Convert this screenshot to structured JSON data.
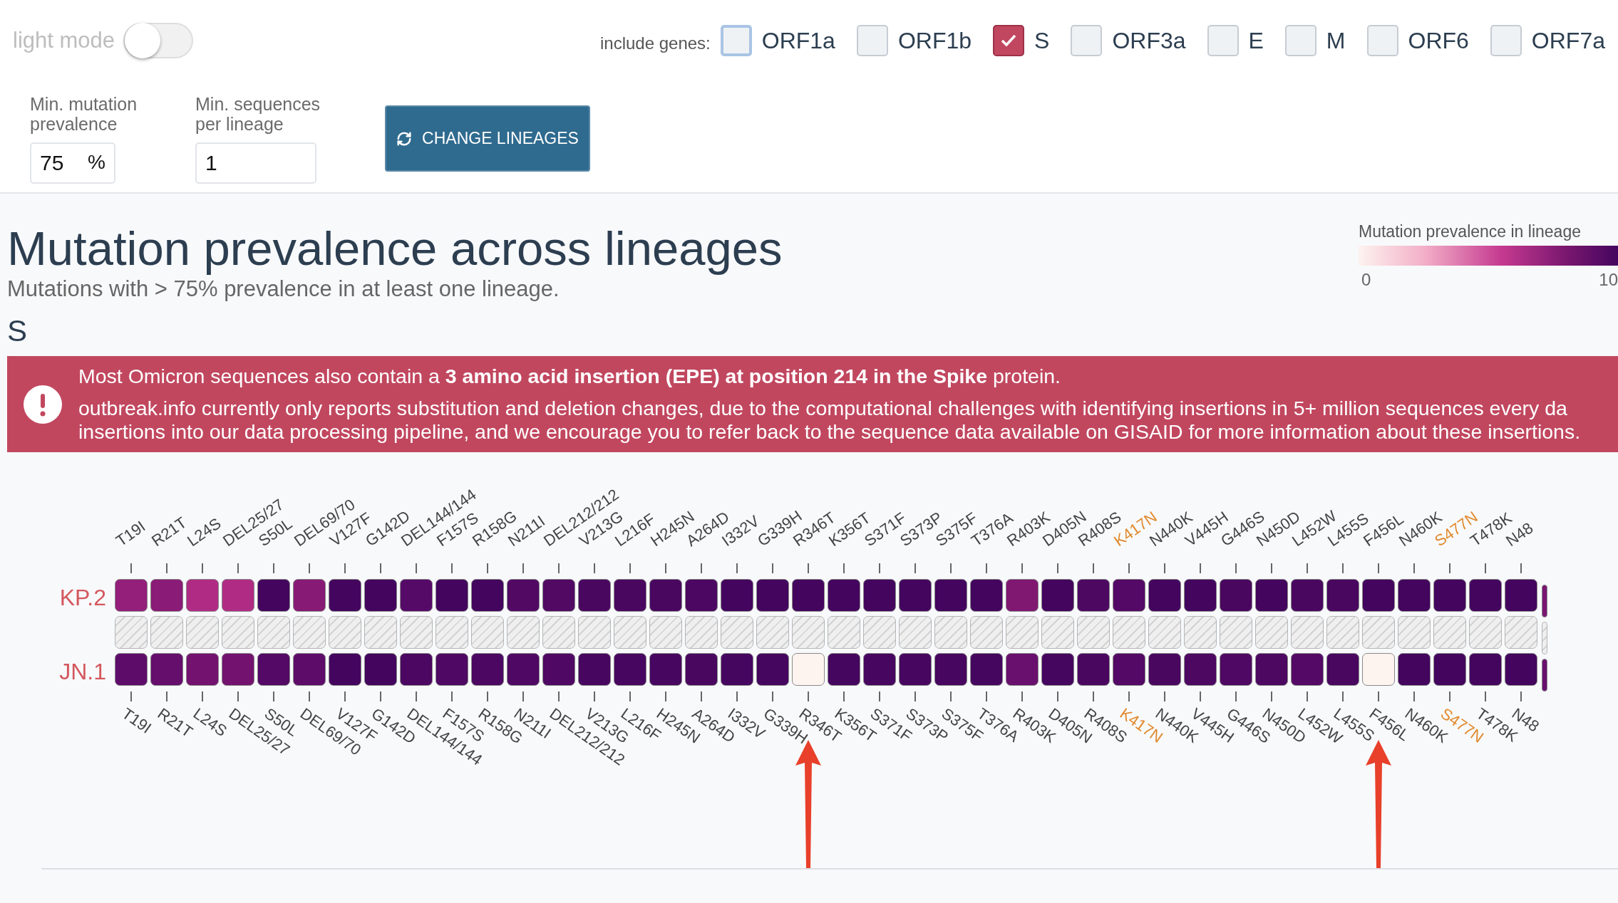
{
  "top_bar": {
    "light_mode": {
      "label": "light mode",
      "on": false
    },
    "genes_label": "include genes:",
    "genes": [
      {
        "label": "ORF1a",
        "checked": false,
        "focused": true
      },
      {
        "label": "ORF1b",
        "checked": false,
        "focused": false
      },
      {
        "label": "S",
        "checked": true,
        "focused": false
      },
      {
        "label": "ORF3a",
        "checked": false,
        "focused": false
      },
      {
        "label": "E",
        "checked": false,
        "focused": false
      },
      {
        "label": "M",
        "checked": false,
        "focused": false
      },
      {
        "label": "ORF6",
        "checked": false,
        "focused": false
      },
      {
        "label": "ORF7a",
        "checked": false,
        "focused": false
      }
    ]
  },
  "filters": [
    {
      "label": "Min. mutation prevalence",
      "value": "75",
      "unit": "%"
    },
    {
      "label": "Min. sequences per lineage",
      "value": "1"
    }
  ],
  "change_button": "CHANGE LINEAGES",
  "title": "Mutation prevalence across lineages",
  "subtitle": "Mutations with > 75% prevalence in at least one lineage.",
  "legend": {
    "title": "Mutation prevalence in lineage",
    "min": "0",
    "max": "10"
  },
  "gene_heading": "S",
  "banner": {
    "lines": [
      "Most Omicron sequences also contain a **3 amino acid insertion (EPE) at position 214 in the Spike** protein.",
      "outbreak.info currently only reports substitution and deletion changes, due to the computational challenges with identifying insertions in 5+ million sequences every da",
      "insertions into our data processing pipeline, and we encourage you to refer back to the sequence data available on GISAID for more information about these insertions."
    ]
  },
  "heatmap": {
    "columns": [
      {
        "top": "T19I",
        "bottom": "T19I",
        "color": "#444444",
        "arrow": false
      },
      {
        "top": "R21T",
        "bottom": "R21T",
        "color": "#444444",
        "arrow": false
      },
      {
        "top": "L24S",
        "bottom": "L24S",
        "color": "#444444",
        "arrow": false
      },
      {
        "top": "DEL25/27",
        "bottom": "DEL25/27",
        "color": "#444444",
        "arrow": false
      },
      {
        "top": "S50L",
        "bottom": "S50L",
        "color": "#444444",
        "arrow": false
      },
      {
        "top": "DEL69/70",
        "bottom": "DEL69/70",
        "color": "#444444",
        "arrow": false
      },
      {
        "top": "V127F",
        "bottom": "V127F",
        "color": "#444444",
        "arrow": false
      },
      {
        "top": "G142D",
        "bottom": "G142D",
        "color": "#444444",
        "arrow": false
      },
      {
        "top": "DEL144/144",
        "bottom": "DEL144/144",
        "color": "#444444",
        "arrow": false
      },
      {
        "top": "F157S",
        "bottom": "F157S",
        "color": "#444444",
        "arrow": false
      },
      {
        "top": "R158G",
        "bottom": "R158G",
        "color": "#444444",
        "arrow": false
      },
      {
        "top": "N211I",
        "bottom": "N211I",
        "color": "#444444",
        "arrow": false
      },
      {
        "top": "DEL212/212",
        "bottom": "DEL212/212",
        "color": "#444444",
        "arrow": false
      },
      {
        "top": "V213G",
        "bottom": "V213G",
        "color": "#444444",
        "arrow": false
      },
      {
        "top": "L216F",
        "bottom": "L216F",
        "color": "#444444",
        "arrow": false
      },
      {
        "top": "H245N",
        "bottom": "H245N",
        "color": "#444444",
        "arrow": false
      },
      {
        "top": "A264D",
        "bottom": "A264D",
        "color": "#444444",
        "arrow": false
      },
      {
        "top": "I332V",
        "bottom": "I332V",
        "color": "#444444",
        "arrow": false
      },
      {
        "top": "G339H",
        "bottom": "G339H",
        "color": "#444444",
        "arrow": false
      },
      {
        "top": "R346T",
        "bottom": "R346T",
        "color": "#444444",
        "arrow": true
      },
      {
        "top": "K356T",
        "bottom": "K356T",
        "color": "#444444",
        "arrow": false
      },
      {
        "top": "S371F",
        "bottom": "S371F",
        "color": "#444444",
        "arrow": false
      },
      {
        "top": "S373P",
        "bottom": "S373P",
        "color": "#444444",
        "arrow": false
      },
      {
        "top": "S375F",
        "bottom": "S375F",
        "color": "#444444",
        "arrow": false
      },
      {
        "top": "T376A",
        "bottom": "T376A",
        "color": "#444444",
        "arrow": false
      },
      {
        "top": "R403K",
        "bottom": "R403K",
        "color": "#444444",
        "arrow": false
      },
      {
        "top": "D405N",
        "bottom": "D405N",
        "color": "#444444",
        "arrow": false
      },
      {
        "top": "R408S",
        "bottom": "R408S",
        "color": "#444444",
        "arrow": false
      },
      {
        "top": "K417N",
        "bottom": "K417N",
        "color": "#e0892c",
        "arrow": false
      },
      {
        "top": "N440K",
        "bottom": "N440K",
        "color": "#444444",
        "arrow": false
      },
      {
        "top": "V445H",
        "bottom": "V445H",
        "color": "#444444",
        "arrow": false
      },
      {
        "top": "G446S",
        "bottom": "G446S",
        "color": "#444444",
        "arrow": false
      },
      {
        "top": "N450D",
        "bottom": "N450D",
        "color": "#444444",
        "arrow": false
      },
      {
        "top": "L452W",
        "bottom": "L452W",
        "color": "#444444",
        "arrow": false
      },
      {
        "top": "L455S",
        "bottom": "L455S",
        "color": "#444444",
        "arrow": false
      },
      {
        "top": "F456L",
        "bottom": "F456L",
        "color": "#444444",
        "arrow": true
      },
      {
        "top": "N460K",
        "bottom": "N460K",
        "color": "#444444",
        "arrow": false
      },
      {
        "top": "S477N",
        "bottom": "S477N",
        "color": "#e0892c",
        "arrow": false
      },
      {
        "top": "T478K",
        "bottom": "T478K",
        "color": "#444444",
        "arrow": false
      },
      {
        "top": "N48",
        "bottom": "N48",
        "color": "#444444",
        "arrow": false
      }
    ],
    "rows": [
      {
        "kind": "lineage",
        "label": "KP.2",
        "cells": [
          {
            "color": "#931f7a"
          },
          {
            "color": "#8a1b76"
          },
          {
            "color": "#b02c84"
          },
          {
            "color": "#b02c84"
          },
          {
            "color": "#43055e"
          },
          {
            "color": "#871a74"
          },
          {
            "color": "#43055e"
          },
          {
            "color": "#43055e"
          },
          {
            "color": "#560a68"
          },
          {
            "color": "#43055e"
          },
          {
            "color": "#43055e"
          },
          {
            "color": "#510964"
          },
          {
            "color": "#510964"
          },
          {
            "color": "#490760"
          },
          {
            "color": "#490760"
          },
          {
            "color": "#490760"
          },
          {
            "color": "#4b0761"
          },
          {
            "color": "#43055e"
          },
          {
            "color": "#43055e"
          },
          {
            "color": "#43055e"
          },
          {
            "color": "#43055e"
          },
          {
            "color": "#43055e"
          },
          {
            "color": "#43055e"
          },
          {
            "color": "#43055e"
          },
          {
            "color": "#43055e"
          },
          {
            "color": "#801872"
          },
          {
            "color": "#43055e"
          },
          {
            "color": "#4d0862"
          },
          {
            "color": "#530965"
          },
          {
            "color": "#43055e"
          },
          {
            "color": "#43055e"
          },
          {
            "color": "#490760"
          },
          {
            "color": "#43055e"
          },
          {
            "color": "#490760"
          },
          {
            "color": "#490760"
          },
          {
            "color": "#43055e"
          },
          {
            "color": "#43055e"
          },
          {
            "color": "#43055e"
          },
          {
            "color": "#43055e"
          },
          {
            "color": "#43055e"
          },
          {
            "color": "#7a1671"
          }
        ]
      },
      {
        "kind": "no-data"
      },
      {
        "kind": "lineage",
        "label": "JN.1",
        "cells": [
          {
            "color": "#5e0c6a"
          },
          {
            "color": "#650e6c"
          },
          {
            "color": "#73136f"
          },
          {
            "color": "#73136f"
          },
          {
            "color": "#530965"
          },
          {
            "color": "#5e0c6a"
          },
          {
            "color": "#43055e"
          },
          {
            "color": "#43055e"
          },
          {
            "color": "#4b0761"
          },
          {
            "color": "#4f0863"
          },
          {
            "color": "#4b0761"
          },
          {
            "color": "#4f0863"
          },
          {
            "color": "#4f0863"
          },
          {
            "color": "#47065f"
          },
          {
            "color": "#47065f"
          },
          {
            "color": "#47065f"
          },
          {
            "color": "#490760"
          },
          {
            "color": "#45065f"
          },
          {
            "color": "#45065f"
          },
          {
            "color": "#fdf3ef"
          },
          {
            "color": "#45065f"
          },
          {
            "color": "#47065f"
          },
          {
            "color": "#47065f"
          },
          {
            "color": "#47065f"
          },
          {
            "color": "#45065f"
          },
          {
            "color": "#69106e"
          },
          {
            "color": "#45065f"
          },
          {
            "color": "#490760"
          },
          {
            "color": "#530965"
          },
          {
            "color": "#490760"
          },
          {
            "color": "#4d0862"
          },
          {
            "color": "#4f0863"
          },
          {
            "color": "#4d0862"
          },
          {
            "color": "#530965"
          },
          {
            "color": "#490760"
          },
          {
            "color": "#fdf3ef"
          },
          {
            "color": "#43055e"
          },
          {
            "color": "#43055e"
          },
          {
            "color": "#43055e"
          },
          {
            "color": "#43055e"
          },
          {
            "color": "#69106e"
          }
        ]
      }
    ]
  }
}
